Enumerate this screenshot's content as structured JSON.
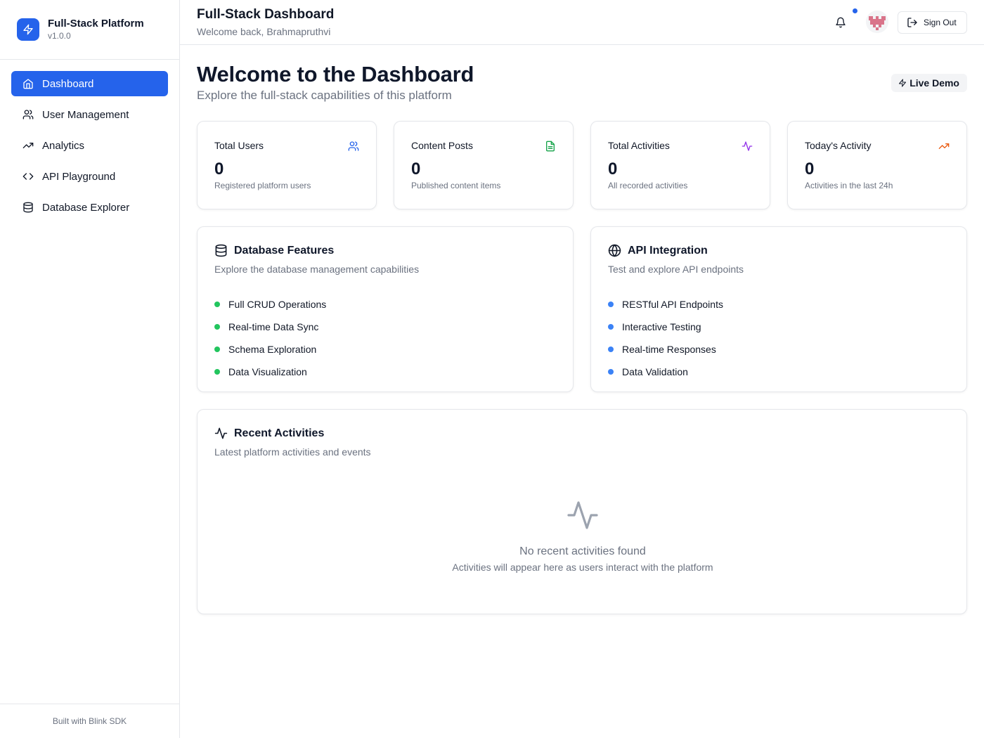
{
  "brand": {
    "name": "Full-Stack Platform",
    "version": "v1.0.0",
    "logo_icon": "zap-icon",
    "accent": "#2563eb"
  },
  "sidebar": {
    "items": [
      {
        "label": "Dashboard",
        "icon": "home-icon",
        "active": true
      },
      {
        "label": "User Management",
        "icon": "users-icon",
        "active": false
      },
      {
        "label": "Analytics",
        "icon": "trending-up-icon",
        "active": false
      },
      {
        "label": "API Playground",
        "icon": "code-icon",
        "active": false
      },
      {
        "label": "Database Explorer",
        "icon": "database-icon",
        "active": false
      }
    ],
    "footer": "Built with Blink SDK"
  },
  "header": {
    "title": "Full-Stack Dashboard",
    "subtitle": "Welcome back, Brahmapruthvi",
    "notification_icon": "bell-icon",
    "notification_dot_color": "#2563eb",
    "sign_out_label": "Sign Out"
  },
  "main": {
    "title": "Welcome to the Dashboard",
    "subtitle": "Explore the full-stack capabilities of this platform",
    "badge": "Live Demo",
    "stats": [
      {
        "title": "Total Users",
        "value": "0",
        "description": "Registered platform users",
        "icon": "users-icon",
        "color": "#2563eb"
      },
      {
        "title": "Content Posts",
        "value": "0",
        "description": "Published content items",
        "icon": "file-text-icon",
        "color": "#16a34a"
      },
      {
        "title": "Total Activities",
        "value": "0",
        "description": "All recorded activities",
        "icon": "activity-icon",
        "color": "#9333ea"
      },
      {
        "title": "Today's Activity",
        "value": "0",
        "description": "Activities in the last 24h",
        "icon": "trending-up-icon",
        "color": "#ea580c"
      }
    ],
    "database_features": {
      "title": "Database Features",
      "subtitle": "Explore the database management capabilities",
      "dot_color": "#22c55e",
      "items": [
        "Full CRUD Operations",
        "Real-time Data Sync",
        "Schema Exploration",
        "Data Visualization"
      ]
    },
    "api_integration": {
      "title": "API Integration",
      "subtitle": "Test and explore API endpoints",
      "dot_color": "#3b82f6",
      "items": [
        "RESTful API Endpoints",
        "Interactive Testing",
        "Real-time Responses",
        "Data Validation"
      ]
    },
    "recent_activities": {
      "title": "Recent Activities",
      "subtitle": "Latest platform activities and events",
      "empty_title": "No recent activities found",
      "empty_description": "Activities will appear here as users interact with the platform"
    }
  }
}
